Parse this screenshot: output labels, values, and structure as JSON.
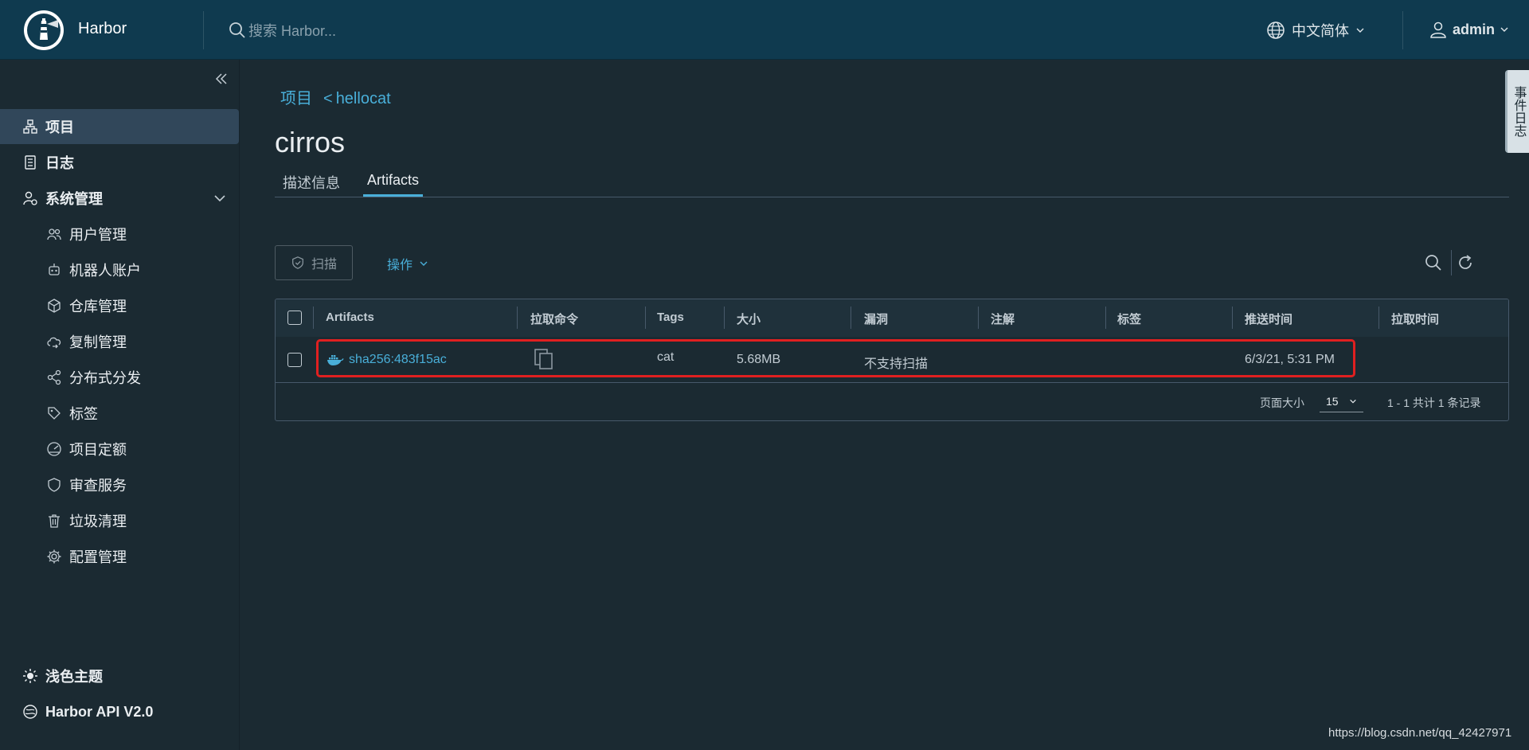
{
  "header": {
    "brand": "Harbor",
    "search_placeholder": "搜索 Harbor...",
    "language": "中文简体",
    "user": "admin"
  },
  "sidebar": {
    "items": [
      {
        "label": "项目",
        "icon": "projects-icon",
        "active": true
      },
      {
        "label": "日志",
        "icon": "logs-icon"
      },
      {
        "label": "系统管理",
        "icon": "admin-icon"
      },
      {
        "label": "用户管理",
        "icon": "users-icon"
      },
      {
        "label": "机器人账户",
        "icon": "robot-icon"
      },
      {
        "label": "仓库管理",
        "icon": "registry-icon"
      },
      {
        "label": "复制管理",
        "icon": "replication-icon"
      },
      {
        "label": "分布式分发",
        "icon": "distribution-icon"
      },
      {
        "label": "标签",
        "icon": "tag-icon"
      },
      {
        "label": "项目定额",
        "icon": "quota-icon"
      },
      {
        "label": "审查服务",
        "icon": "shield-icon"
      },
      {
        "label": "垃圾清理",
        "icon": "trash-icon"
      },
      {
        "label": "配置管理",
        "icon": "gear-icon"
      }
    ],
    "bottom": [
      {
        "label": "浅色主题",
        "icon": "sun-icon"
      },
      {
        "label": "Harbor API V2.0",
        "icon": "api-icon"
      }
    ]
  },
  "breadcrumb": {
    "root": "项目",
    "sep": "<",
    "project": "hellocat"
  },
  "page_title": "cirros",
  "tabs": [
    {
      "label": "描述信息",
      "active": false
    },
    {
      "label": "Artifacts",
      "active": true
    }
  ],
  "toolbar": {
    "scan": "扫描",
    "actions": "操作"
  },
  "table": {
    "columns": [
      "Artifacts",
      "拉取命令",
      "Tags",
      "大小",
      "漏洞",
      "注解",
      "标签",
      "推送时间",
      "拉取时间"
    ],
    "rows": [
      {
        "digest": "sha256:483f15ac",
        "tags": "cat",
        "size": "5.68MB",
        "vulnerabilities": "不支持扫描",
        "annotations": "",
        "labels": "",
        "push_time": "6/3/21, 5:31 PM",
        "pull_time": ""
      }
    ],
    "footer": {
      "page_size_label": "页面大小",
      "page_size": "15",
      "page_info": "1 - 1 共计 1 条记录"
    }
  },
  "event_log": "事件日志",
  "watermark": "https://blog.csdn.net/qq_42427971",
  "colors": {
    "header_bg": "#0f3a4f",
    "body_bg": "#1b2a32",
    "accent": "#49afd9",
    "highlight": "#e02020"
  }
}
